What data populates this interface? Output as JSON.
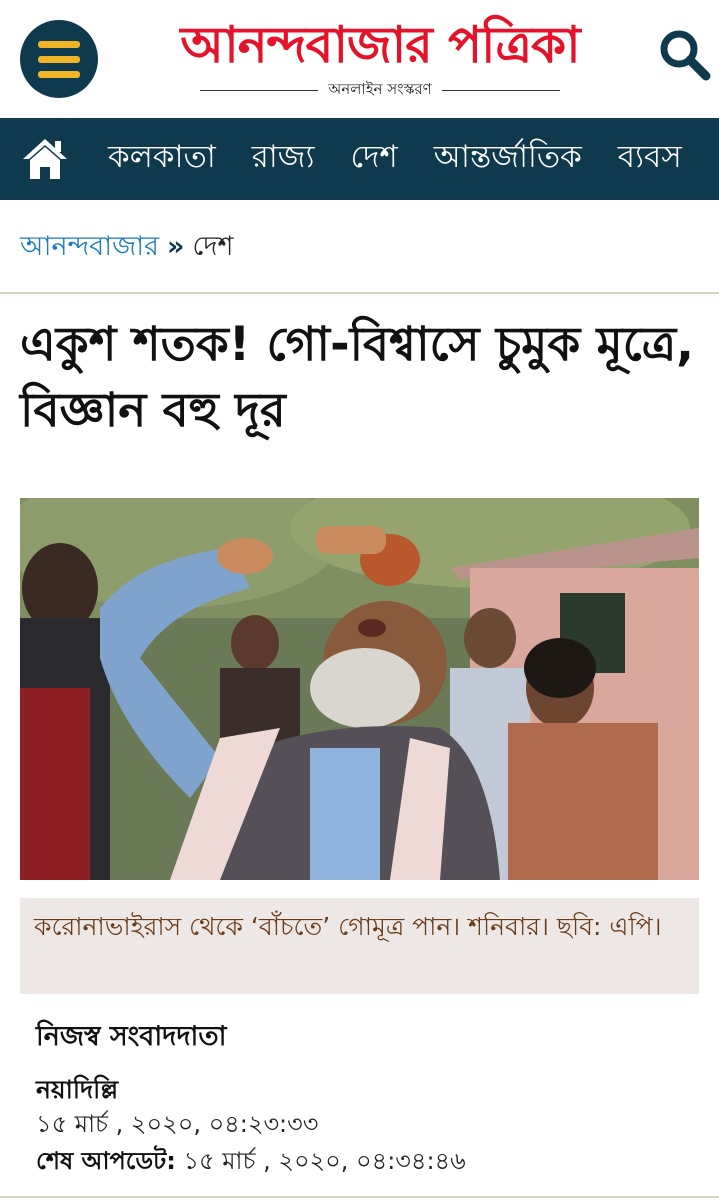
{
  "header": {
    "logo_text": "আনন্দবাজার পত্রিকা",
    "edition": "অনলাইন সংস্করণ",
    "menu_icon": "hamburger-icon",
    "search_icon": "search-icon",
    "colors": {
      "brand_red": "#e5132a",
      "nav_bg": "#0f3a4e",
      "menu_accent": "#f0b429"
    }
  },
  "nav": {
    "home_icon": "home-icon",
    "items": [
      {
        "label": "কলকাতা"
      },
      {
        "label": "রাজ্য"
      },
      {
        "label": "দেশ"
      },
      {
        "label": "আন্তর্জাতিক"
      },
      {
        "label": "ব্যবস"
      }
    ]
  },
  "breadcrumb": {
    "home": "আনন্দবাজার",
    "separator": "»",
    "current": "দেশ"
  },
  "article": {
    "headline": "একুশ শতক! গো-বিশ্বাসে চুমুক মূত্রে, বিজ্ঞান বহু দূর",
    "caption": "করোনাভাইরাস থেকে ‘বাঁচতে’ গোমূত্র পান। শনিবার। ছবি: এপি।",
    "byline": "নিজস্ব সংবাদদাতা",
    "dateline": "নয়াদিল্লি",
    "published": "১৫ মার্চ , ২০২০, ০৪:২৩:৩৩",
    "updated_label": "শেষ আপডেট:",
    "updated": "১৫ মার্চ , ২০২০, ০৪:৩৪:৪৬"
  }
}
